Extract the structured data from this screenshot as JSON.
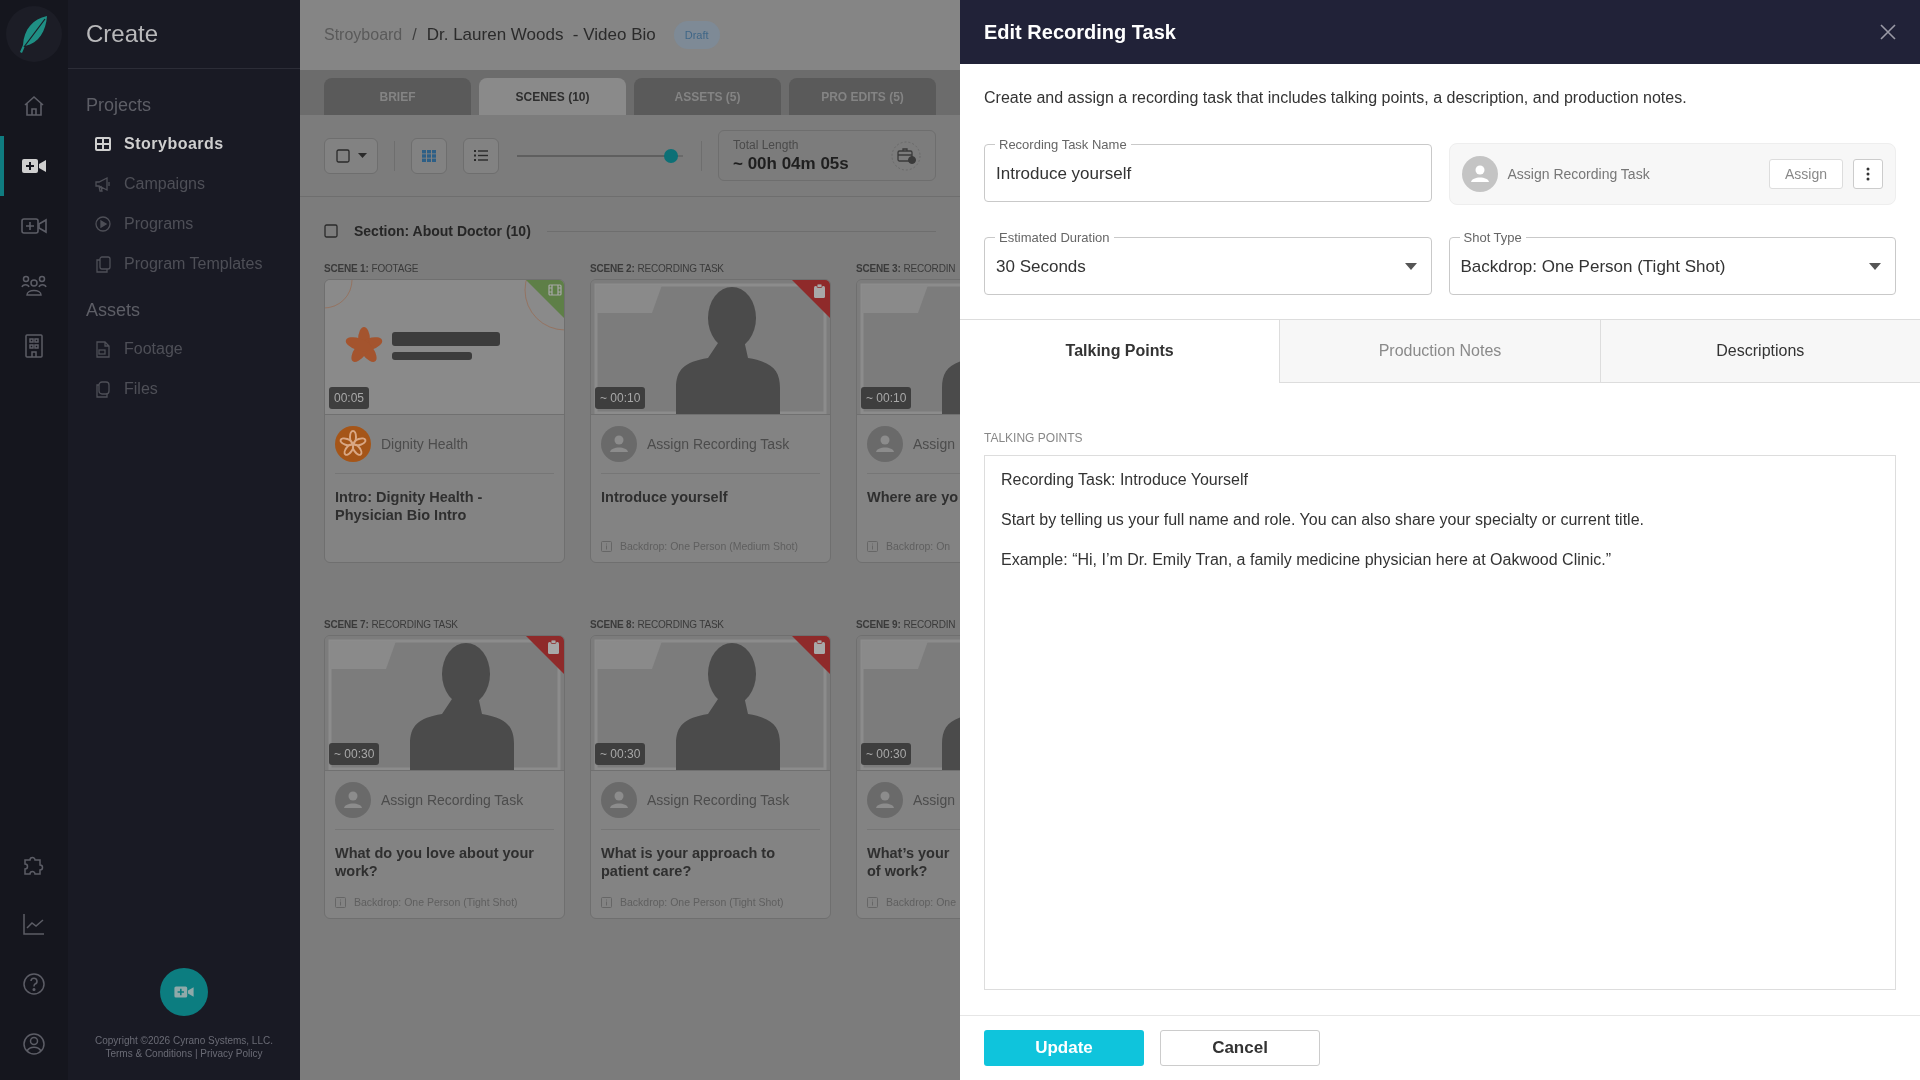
{
  "app": {
    "title": "Create"
  },
  "rail": {
    "top": [
      {
        "kind": "home",
        "selected": false
      },
      {
        "kind": "video-add",
        "selected": true
      },
      {
        "kind": "video-outline",
        "selected": false
      },
      {
        "kind": "people",
        "selected": false
      },
      {
        "kind": "building",
        "selected": false
      }
    ],
    "bottom": [
      {
        "kind": "puzzle",
        "selected": false
      },
      {
        "kind": "chart",
        "selected": false
      },
      {
        "kind": "help",
        "selected": false
      },
      {
        "kind": "account",
        "selected": false
      }
    ]
  },
  "sidebar": [
    {
      "heading": "Projects",
      "items": [
        {
          "label": "Storyboards",
          "kind": "grid",
          "selected": true
        },
        {
          "label": "Campaigns",
          "kind": "megaphone",
          "selected": false
        },
        {
          "label": "Programs",
          "kind": "play",
          "selected": false
        },
        {
          "label": "Program Templates",
          "kind": "copy",
          "selected": false
        }
      ]
    },
    {
      "heading": "Assets",
      "items": [
        {
          "label": "Footage",
          "kind": "file-video",
          "selected": false
        },
        {
          "label": "Files",
          "kind": "files",
          "selected": false
        }
      ]
    }
  ],
  "footer": {
    "copyright": "Copyright ©2026 Cyrano Systems, LLC.",
    "links": [
      "Terms & Conditions",
      "Privacy Policy"
    ],
    "separator": "|"
  },
  "breadcrumb": {
    "parent": "Stroyboard",
    "separator": "/",
    "current": "Dr. Lauren Woods  - Video Bio",
    "status": "Draft"
  },
  "tabs": [
    {
      "label": "BRIEF",
      "selected": false
    },
    {
      "label": "SCENES (10)",
      "selected": true
    },
    {
      "label": "ASSETS (5)",
      "selected": false
    },
    {
      "label": "PRO EDITS (5)",
      "selected": false
    }
  ],
  "toolbar": {
    "select_all": {
      "checked": false
    },
    "views": [
      {
        "kind": "grid",
        "selected": true
      },
      {
        "kind": "list",
        "selected": false
      }
    ],
    "zoom": {
      "level": 0.97
    },
    "total_length": {
      "label": "Total Length",
      "value": "~ 00h 04m 05s"
    }
  },
  "section": {
    "title": "Section: About Doctor (10)",
    "checked": false
  },
  "scene_rows": [
    [
      {
        "number": "SCENE 1:",
        "type": "FOOTAGE",
        "kind": "footage",
        "duration": "00:05",
        "assignee": "Dignity Health",
        "title": "Intro: Dignity Health - Physician Bio Intro"
      },
      {
        "number": "SCENE 2:",
        "type": "RECORDING TASK",
        "kind": "recording",
        "duration": "~ 00:10",
        "assignee": "Assign Recording Task",
        "title": "Introduce yourself",
        "shot": "Backdrop: One Person (Medium Shot)"
      },
      {
        "number": "SCENE 3:",
        "type": "RECORDIN",
        "kind": "recording",
        "duration": "~ 00:10",
        "assignee": "Assign",
        "title": "Where are yo",
        "shot": "Backdrop: On"
      }
    ],
    [
      {
        "number": "SCENE 7:",
        "type": "RECORDING TASK",
        "kind": "recording",
        "duration": "~ 00:30",
        "assignee": "Assign Recording Task",
        "title": "What do you love about your\nwork?",
        "shot": "Backdrop: One Person (Tight Shot)"
      },
      {
        "number": "SCENE 8:",
        "type": "RECORDING TASK",
        "kind": "recording",
        "duration": "~ 00:30",
        "assignee": "Assign Recording Task",
        "title": "What is your approach to\npatient care?",
        "shot": "Backdrop: One Person (Tight Shot)"
      },
      {
        "number": "SCENE 9:",
        "type": "RECORDIN",
        "kind": "recording",
        "duration": "~ 00:30",
        "assignee": "Assign",
        "title": "What’s your\nof work?",
        "shot": "Backdrop: One"
      }
    ]
  ],
  "panel": {
    "title": "Edit Recording Task",
    "description": "Create and assign a recording task that includes talking points, a description, and production notes.",
    "fields": [
      {
        "label": "Recording Task Name",
        "value": "Introduce yourself",
        "kind": "text"
      },
      {
        "label": "Estimated Duration",
        "value": "30 Seconds",
        "kind": "select"
      },
      {
        "label": "Shot Type",
        "value": "Backdrop: One Person (Tight Shot)",
        "kind": "select"
      }
    ],
    "assign": {
      "text": "Assign Recording Task",
      "button": "Assign"
    },
    "tabs": [
      {
        "label": "Talking Points",
        "selected": true,
        "disabled": false
      },
      {
        "label": "Production Notes",
        "selected": false,
        "disabled": true
      },
      {
        "label": "Descriptions",
        "selected": false,
        "disabled": false
      }
    ],
    "section_label": "TALKING POINTS",
    "talking_points": [
      "Recording Task: Introduce Yourself",
      "Start by telling us your full name and role. You can also share your specialty or current title.",
      "Example: “Hi, I’m Dr. Emily Tran, a family medicine physician here at Oakwood Clinic.”"
    ],
    "buttons": [
      {
        "label": "Update",
        "kind": "primary"
      },
      {
        "label": "Cancel",
        "kind": "secondary"
      }
    ]
  }
}
